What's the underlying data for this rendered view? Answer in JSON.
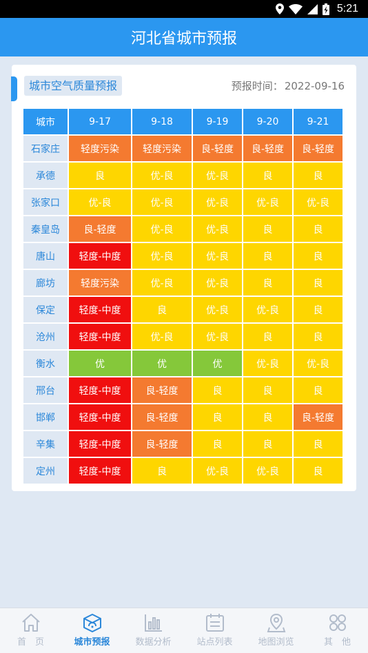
{
  "status": {
    "time": "5:21"
  },
  "title": "河北省城市预报",
  "card": {
    "tag": "城市空气质量预报",
    "date_label": "预报时间：",
    "date_value": "2022-09-16"
  },
  "colors": {
    "primary": "#2b97f0",
    "you": "#85c83a",
    "you_liang": "#fed600",
    "liang": "#fed600",
    "liang_qingdu": "#f47a30",
    "qingdu_wuran": "#f47a30",
    "qingdu_zhongdu": "#f00f0f"
  },
  "table": {
    "headers": [
      "城市",
      "9-17",
      "9-18",
      "9-19",
      "9-20",
      "9-21"
    ],
    "rows": [
      {
        "city": "石家庄",
        "cells": [
          "轻度污染",
          "轻度污染",
          "良-轻度",
          "良-轻度",
          "良-轻度"
        ]
      },
      {
        "city": "承德",
        "cells": [
          "良",
          "优-良",
          "优-良",
          "良",
          "良"
        ]
      },
      {
        "city": "张家口",
        "cells": [
          "优-良",
          "优-良",
          "优-良",
          "优-良",
          "优-良"
        ]
      },
      {
        "city": "秦皇岛",
        "cells": [
          "良-轻度",
          "优-良",
          "优-良",
          "良",
          "良"
        ]
      },
      {
        "city": "唐山",
        "cells": [
          "轻度-中度",
          "优-良",
          "优-良",
          "良",
          "良"
        ]
      },
      {
        "city": "廊坊",
        "cells": [
          "轻度污染",
          "优-良",
          "优-良",
          "良",
          "良"
        ]
      },
      {
        "city": "保定",
        "cells": [
          "轻度-中度",
          "良",
          "优-良",
          "优-良",
          "良"
        ]
      },
      {
        "city": "沧州",
        "cells": [
          "轻度-中度",
          "优-良",
          "优-良",
          "良",
          "良"
        ]
      },
      {
        "city": "衡水",
        "cells": [
          "优",
          "优",
          "优",
          "优-良",
          "优-良"
        ]
      },
      {
        "city": "邢台",
        "cells": [
          "轻度-中度",
          "良-轻度",
          "良",
          "良",
          "良"
        ]
      },
      {
        "city": "邯郸",
        "cells": [
          "轻度-中度",
          "良-轻度",
          "良",
          "良",
          "良-轻度"
        ]
      },
      {
        "city": "辛集",
        "cells": [
          "轻度-中度",
          "良-轻度",
          "良",
          "良",
          "良"
        ]
      },
      {
        "city": "定州",
        "cells": [
          "轻度-中度",
          "良",
          "优-良",
          "优-良",
          "良"
        ]
      }
    ]
  },
  "tabs": [
    {
      "label": "首　页",
      "icon": "home-icon"
    },
    {
      "label": "城市预报",
      "icon": "city-forecast-icon",
      "active": true
    },
    {
      "label": "数据分析",
      "icon": "bar-chart-icon"
    },
    {
      "label": "站点列表",
      "icon": "list-icon"
    },
    {
      "label": "地图浏览",
      "icon": "map-pin-icon"
    },
    {
      "label": "其　他",
      "icon": "more-icon"
    }
  ]
}
